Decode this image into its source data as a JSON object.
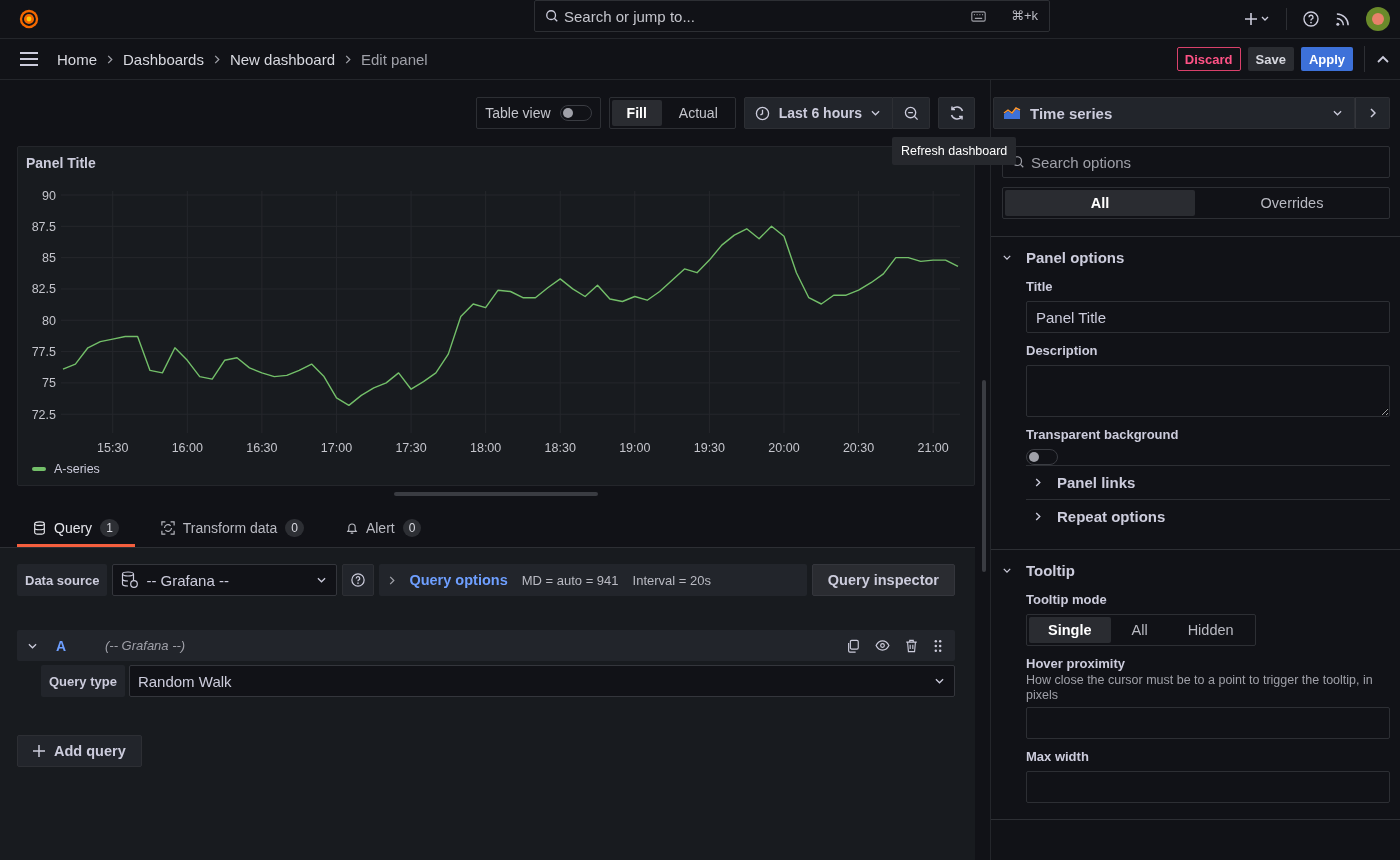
{
  "topbar": {
    "search": {
      "placeholder": "Search or jump to..."
    },
    "shortcut": "⌘+k"
  },
  "breadcrumbs": [
    {
      "label": "Home",
      "current": false
    },
    {
      "label": "Dashboards",
      "current": false
    },
    {
      "label": "New dashboard",
      "current": false
    },
    {
      "label": "Edit panel",
      "current": true
    }
  ],
  "actions": [
    {
      "label": "Discard",
      "kind": "danger"
    },
    {
      "label": "Save",
      "kind": "secondary"
    },
    {
      "label": "Apply",
      "kind": "primary"
    }
  ],
  "toolbar": {
    "table_view": {
      "label": "Table view",
      "on": false
    },
    "size_modes": [
      {
        "label": "Fill",
        "selected": true
      },
      {
        "label": "Actual",
        "selected": false
      }
    ],
    "time_range": "Last 6 hours",
    "tooltip": "Refresh dashboard"
  },
  "visualization": "Time series",
  "panel": {
    "title": "Panel Title",
    "chart_data": {
      "type": "line",
      "grid": true,
      "ylim": [
        71,
        90
      ],
      "categories": [
        null,
        null,
        null,
        null,
        "15:30",
        null,
        null,
        null,
        null,
        null,
        "16:00",
        null,
        null,
        null,
        null,
        null,
        "16:30",
        null,
        null,
        null,
        null,
        null,
        "17:00",
        null,
        null,
        null,
        null,
        null,
        "17:30",
        null,
        null,
        null,
        null,
        null,
        "18:00",
        null,
        null,
        null,
        null,
        null,
        "18:30",
        null,
        null,
        null,
        null,
        null,
        "19:00",
        null,
        null,
        null,
        null,
        null,
        "19:30",
        null,
        null,
        null,
        null,
        null,
        "20:00",
        null,
        null,
        null,
        null,
        null,
        "20:30",
        null,
        null,
        null,
        null,
        null,
        "21:00",
        null,
        null
      ],
      "yticks": [
        {
          "value": 72.5,
          "label": "72.5"
        },
        {
          "value": 75,
          "label": "75"
        },
        {
          "value": 77.5,
          "label": "77.5"
        },
        {
          "value": 80,
          "label": "80"
        },
        {
          "value": 82.5,
          "label": "82.5"
        },
        {
          "value": 85,
          "label": "85"
        },
        {
          "value": 87.5,
          "label": "87.5"
        },
        {
          "value": 90,
          "label": "90"
        }
      ],
      "series": [
        {
          "name": "A-series",
          "color": "#73bf69",
          "values": [
            76.1,
            76.5,
            77.8,
            78.3,
            78.5,
            78.7,
            78.7,
            76,
            75.8,
            77.8,
            76.8,
            75.5,
            75.3,
            76.8,
            77,
            76.2,
            75.8,
            75.5,
            75.6,
            76,
            76.5,
            75.5,
            73.8,
            73.2,
            74,
            74.6,
            75,
            75.8,
            74.5,
            75.1,
            75.8,
            77.3,
            80.3,
            81.3,
            81,
            82.4,
            82.3,
            81.8,
            81.8,
            82.6,
            83.3,
            82.5,
            81.9,
            82.8,
            81.7,
            81.5,
            81.9,
            81.6,
            82.3,
            83.2,
            84.1,
            83.8,
            84.8,
            86,
            86.8,
            87.3,
            86.5,
            87.5,
            86.7,
            83.8,
            81.8,
            81.3,
            82,
            82,
            82.4,
            83,
            83.7,
            85,
            85,
            84.7,
            84.8,
            84.8,
            84.3
          ]
        }
      ]
    }
  },
  "query_tabs": [
    {
      "label": "Query",
      "count": "1",
      "kind": "database",
      "selected": true
    },
    {
      "label": "Transform data",
      "count": "0",
      "kind": "transform",
      "selected": false
    },
    {
      "label": "Alert",
      "count": "0",
      "kind": "bell",
      "selected": false
    }
  ],
  "query": {
    "data_source_label": "Data source",
    "data_source": "-- Grafana --",
    "options_label": "Query options",
    "options_info": [
      "MD = auto = 941",
      "Interval = 20s"
    ],
    "inspector": "Query inspector",
    "rows": [
      {
        "ref": "A",
        "source": "(-- Grafana --)",
        "expanded": true,
        "query_type_label": "Query type",
        "query_type": "Random Walk"
      }
    ],
    "add": "Add query"
  },
  "options": {
    "search": {
      "placeholder": "Search options"
    },
    "tabs": [
      {
        "label": "All",
        "selected": true
      },
      {
        "label": "Overrides",
        "selected": false
      }
    ],
    "sections": [
      {
        "title": "Panel options",
        "expanded": true,
        "items": [
          {
            "kind": "input",
            "label": "Title",
            "value": "Panel Title"
          },
          {
            "kind": "textarea",
            "label": "Description"
          },
          {
            "kind": "switch",
            "label": "Transparent background",
            "on": false
          },
          {
            "kind": "group",
            "label": "Panel links",
            "expanded": false
          },
          {
            "kind": "group",
            "label": "Repeat options",
            "expanded": false
          }
        ]
      },
      {
        "title": "Tooltip",
        "expanded": true,
        "items": [
          {
            "kind": "radio",
            "label": "Tooltip mode",
            "choices": [
              {
                "label": "Single",
                "selected": true
              },
              {
                "label": "All",
                "selected": false
              },
              {
                "label": "Hidden",
                "selected": false
              }
            ]
          },
          {
            "kind": "input",
            "label": "Hover proximity",
            "description": "How close the cursor must be to a point to trigger the tooltip, in pixels"
          },
          {
            "kind": "input",
            "label": "Max width"
          }
        ]
      }
    ]
  }
}
